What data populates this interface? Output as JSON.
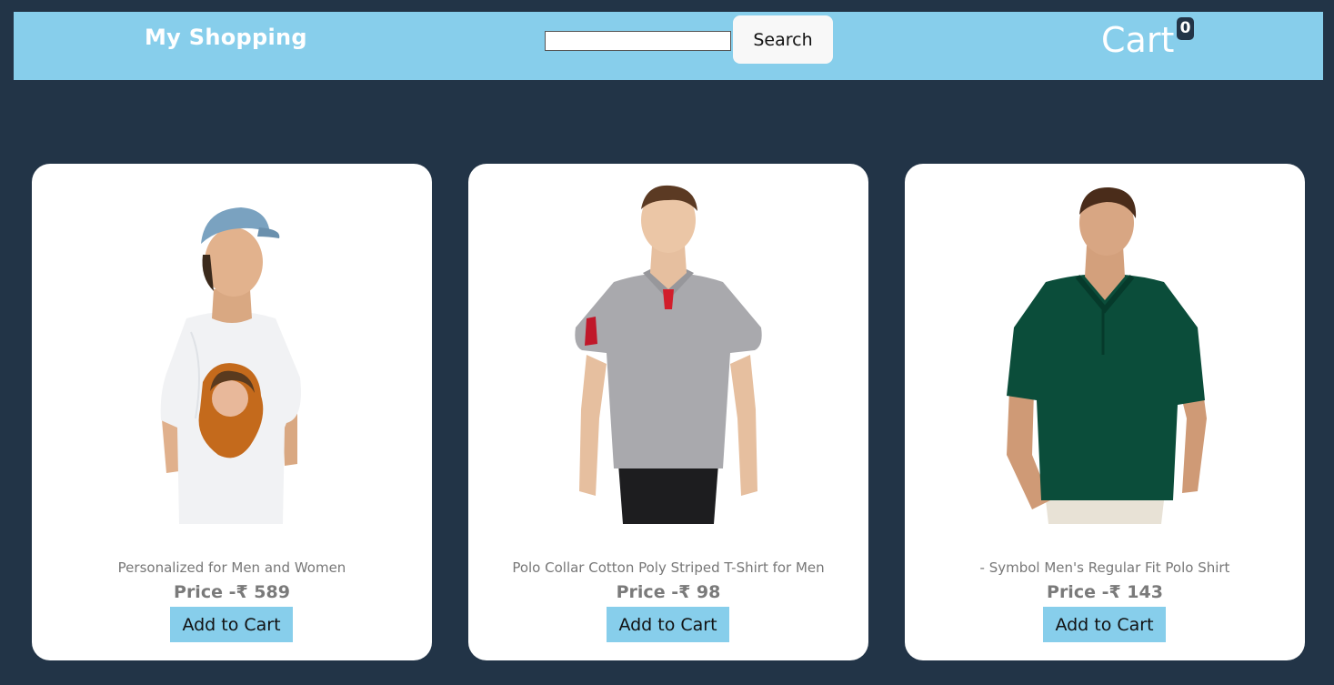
{
  "header": {
    "brand": "My Shopping",
    "search_placeholder": "",
    "search_button": "Search",
    "cart_label": "Cart",
    "cart_count": "0"
  },
  "products": [
    {
      "title": "Personalized for Men and Women",
      "price": "Price -₹ 589",
      "button": "Add to Cart",
      "image": "man-white-printed-tshirt-cap"
    },
    {
      "title": "Polo Collar Cotton Poly Striped T-Shirt for Men",
      "price": "Price -₹ 98",
      "button": "Add to Cart",
      "image": "man-grey-polo-shirt"
    },
    {
      "title": "- Symbol Men's Regular Fit Polo Shirt",
      "price": "Price -₹ 143",
      "button": "Add to Cart",
      "image": "man-green-polo-shirt"
    }
  ],
  "colors": {
    "background": "#223447",
    "navbar": "#87ceeb",
    "card": "#ffffff",
    "button": "#87ceeb"
  }
}
